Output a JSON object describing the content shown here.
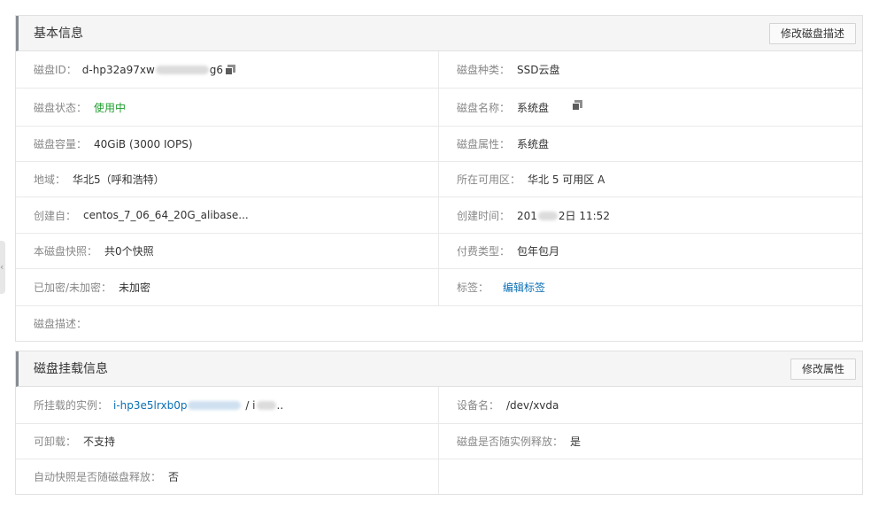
{
  "basic": {
    "title": "基本信息",
    "edit_button": "修改磁盘描述",
    "rows": [
      {
        "left": {
          "label": "磁盘ID：",
          "value_prefix": "d-hp32a97xw",
          "value_suffix": "g6"
        },
        "right": {
          "label": "磁盘种类：",
          "value": "SSD云盘"
        }
      },
      {
        "left": {
          "label": "磁盘状态：",
          "value": "使用中"
        },
        "right": {
          "label": "磁盘名称：",
          "value": "系统盘"
        }
      },
      {
        "left": {
          "label": "磁盘容量：",
          "value": "40GiB (3000 IOPS)"
        },
        "right": {
          "label": "磁盘属性：",
          "value": "系统盘"
        }
      },
      {
        "left": {
          "label": "地域：",
          "value": "华北5（呼和浩特）"
        },
        "right": {
          "label": "所在可用区：",
          "value": "华北 5 可用区 A"
        }
      },
      {
        "left": {
          "label": "创建自：",
          "value": "centos_7_06_64_20G_alibase..."
        },
        "right": {
          "label": "创建时间：",
          "value_prefix": "201",
          "value_suffix": "2日 11:52"
        }
      },
      {
        "left": {
          "label": "本磁盘快照：",
          "value": "共0个快照"
        },
        "right": {
          "label": "付费类型：",
          "value": "包年包月"
        }
      },
      {
        "left": {
          "label": "已加密/未加密：",
          "value": "未加密"
        },
        "right": {
          "label": "标签：",
          "link": "编辑标签"
        }
      },
      {
        "full": {
          "label": "磁盘描述：",
          "value": ""
        }
      }
    ]
  },
  "mount": {
    "title": "磁盘挂载信息",
    "edit_button": "修改属性",
    "rows": [
      {
        "left": {
          "label": "所挂载的实例：",
          "link_prefix": "i-hp3e5lrxb0p",
          "sep": "/ i",
          "tail": ".."
        },
        "right": {
          "label": "设备名：",
          "value": "/dev/xvda"
        }
      },
      {
        "left": {
          "label": "可卸载：",
          "value": "不支持"
        },
        "right": {
          "label": "磁盘是否随实例释放：",
          "value": "是"
        }
      },
      {
        "left": {
          "label": "自动快照是否随磁盘释放：",
          "value": "否"
        },
        "right": {}
      }
    ]
  },
  "colors": {
    "label": "#888888",
    "text": "#333333",
    "status_green": "#1e9e2e",
    "link_blue": "#0a6fb5",
    "header_bg": "#f5f5f6",
    "border": "#e1e1e1"
  },
  "icons": {
    "copy": "copy-icon",
    "side_collapse": "chevron-left-icon"
  }
}
